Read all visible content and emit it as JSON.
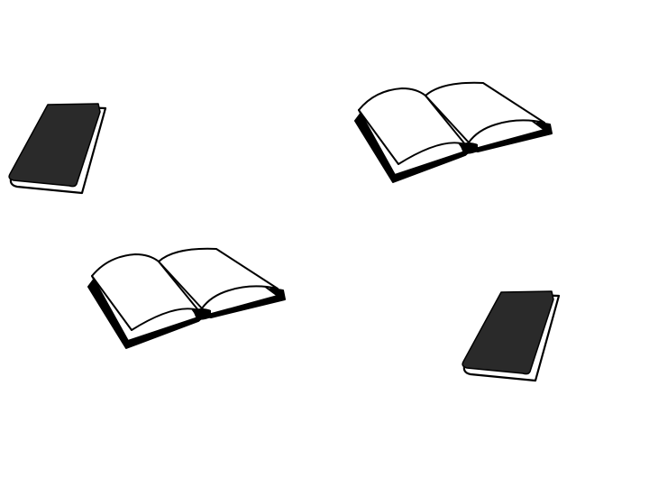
{
  "colors": {
    "background": "#ffffff",
    "cover": "#2a2a2a",
    "outline": "#000000",
    "page": "#ffffff"
  },
  "icons": {
    "closed_book": "closed-book-icon",
    "open_book": "open-book-icon"
  }
}
